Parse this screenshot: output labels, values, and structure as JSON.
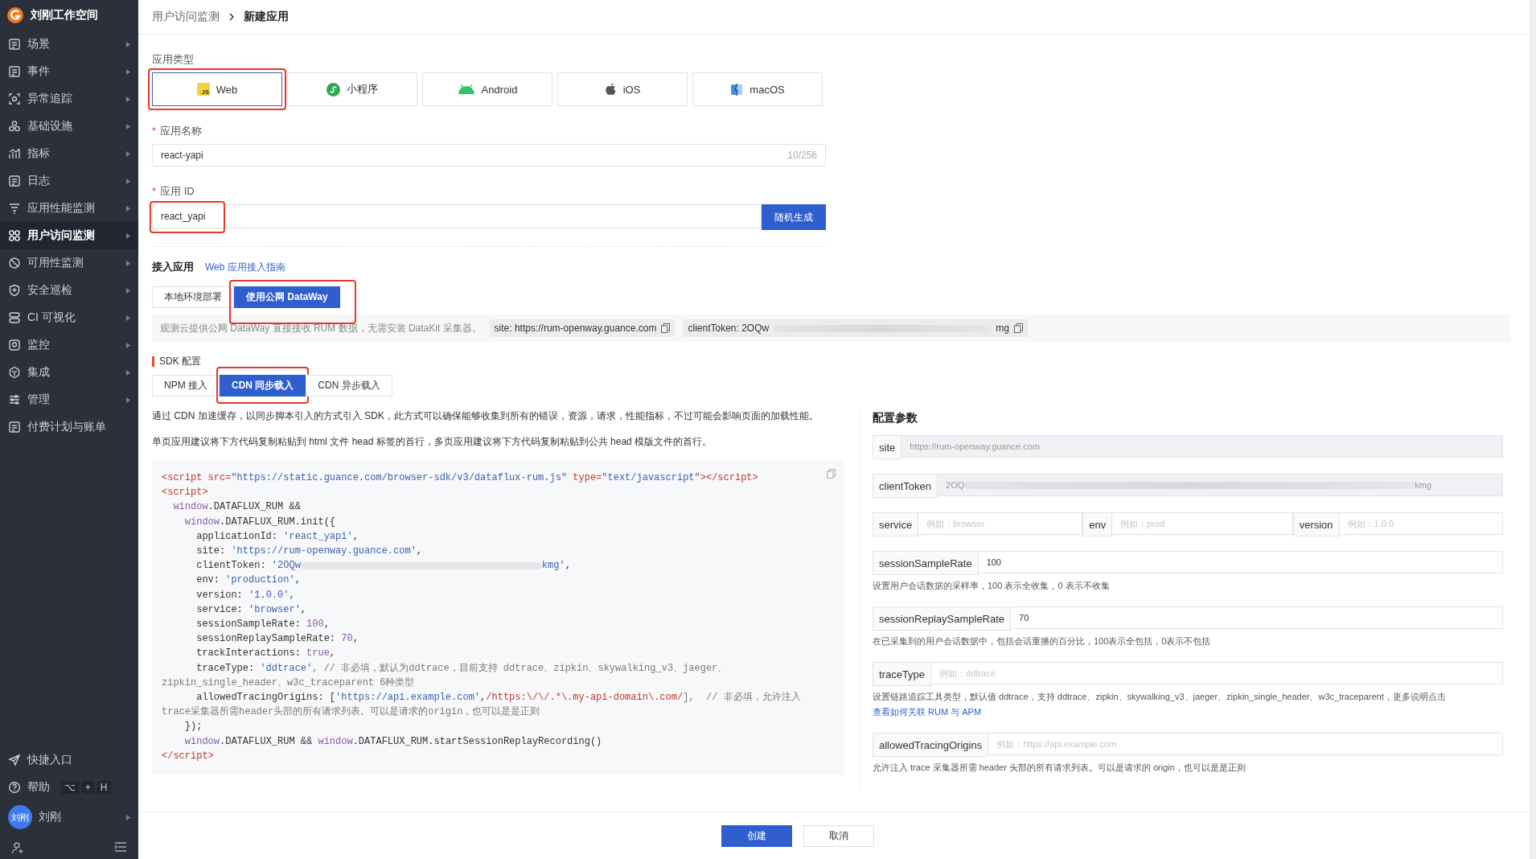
{
  "sidebar": {
    "workspace": "刘刚工作空间",
    "items": [
      {
        "label": "场景",
        "selected": false
      },
      {
        "label": "事件",
        "selected": false
      },
      {
        "label": "异常追踪",
        "selected": false
      },
      {
        "label": "基础设施",
        "selected": false
      },
      {
        "label": "指标",
        "selected": false
      },
      {
        "label": "日志",
        "selected": false
      },
      {
        "label": "应用性能监测",
        "selected": false
      },
      {
        "label": "用户访问监测",
        "selected": true
      },
      {
        "label": "可用性监测",
        "selected": false
      },
      {
        "label": "安全巡检",
        "selected": false
      },
      {
        "label": "CI 可视化",
        "selected": false
      },
      {
        "label": "监控",
        "selected": false
      },
      {
        "label": "集成",
        "selected": false
      },
      {
        "label": "管理",
        "selected": false
      },
      {
        "label": "付费计划与账单",
        "selected": false
      }
    ],
    "shortcut": "快捷入口",
    "help": "帮助",
    "help_keys": [
      "⌥",
      "+",
      "H"
    ],
    "user_avatar": "刘刚",
    "user_name": "刘刚"
  },
  "breadcrumb": [
    "用户访问监测",
    "新建应用"
  ],
  "app_type": {
    "label": "应用类型",
    "options": [
      {
        "label": "Web",
        "icon_text": "JS",
        "selected": true,
        "highlighted": true
      },
      {
        "label": "小程序",
        "selected": false,
        "highlighted": false
      },
      {
        "label": "Android",
        "selected": false,
        "highlighted": false
      },
      {
        "label": "iOS",
        "selected": false,
        "highlighted": false
      },
      {
        "label": "macOS",
        "selected": false,
        "highlighted": false
      }
    ]
  },
  "app_name": {
    "required_mark": "*",
    "label": "应用名称",
    "value": "react-yapi",
    "counter": "10/256"
  },
  "app_id": {
    "required_mark": "*",
    "label": "应用 ID",
    "value": "react_yapi",
    "highlighted": true,
    "button": "随机生成"
  },
  "access": {
    "title": "接入应用",
    "guide_link": "Web 应用接入指南",
    "tabs": [
      {
        "label": "本地环境部署",
        "selected": false,
        "highlighted": false
      },
      {
        "label": "使用公网 DataWay",
        "selected": true,
        "highlighted": true
      }
    ],
    "note": "观测云提供公网 DataWay 直接接收 RUM 数据，无需安装 DataKit 采集器。",
    "site": "site: https://rum-openway.guance.com",
    "token_start": "clientToken: 2OQw",
    "token_end": "mg"
  },
  "sdk": {
    "title": "SDK 配置",
    "tabs": [
      {
        "label": "NPM 接入",
        "selected": false,
        "highlighted": false
      },
      {
        "label": "CDN 同步载入",
        "selected": true,
        "highlighted": true
      },
      {
        "label": "CDN 异步载入",
        "selected": false,
        "highlighted": false
      }
    ],
    "desc": [
      "通过 CDN 加速缓存，以同步脚本引入的方式引入 SDK，此方式可以确保能够收集到所有的错误，资源，请求，性能指标，不过可能会影响页面的加载性能。",
      "单页应用建议将下方代码复制粘贴到 html 文件 head 标签的首行，多页应用建议将下方代码复制粘贴到公共 head 模版文件的首行。"
    ],
    "code": [
      [
        {
          "t": "<script ",
          "kind": "tag"
        },
        {
          "t": "src=",
          "kind": "tag"
        },
        {
          "t": "\"https://static.guance.com/browser-sdk/v3/dataflux-rum.js\"",
          "kind": "str"
        },
        {
          "t": " type=",
          "kind": "tag"
        },
        {
          "t": "\"text/javascript\"",
          "kind": "str"
        },
        {
          "t": "></script>",
          "kind": "tag"
        }
      ],
      [
        {
          "t": "<script>",
          "kind": "tag"
        }
      ],
      [
        {
          "t": "  window",
          "kind": "kw"
        },
        {
          "t": ".DATAFLUX_RUM &&",
          "kind": "plain"
        }
      ],
      [
        {
          "t": "    window",
          "kind": "kw"
        },
        {
          "t": ".DATAFLUX_RUM.init({",
          "kind": "plain"
        }
      ],
      [
        {
          "t": "      applicationId: ",
          "kind": "plain"
        },
        {
          "t": "'react_yapi'",
          "kind": "str"
        },
        {
          "t": ",",
          "kind": "plain"
        }
      ],
      [
        {
          "t": "      site: ",
          "kind": "plain"
        },
        {
          "t": "'https://rum-openway.guance.com'",
          "kind": "str"
        },
        {
          "t": ",",
          "kind": "plain"
        }
      ],
      [
        {
          "t": "      clientToken: ",
          "kind": "plain"
        },
        {
          "t": "'2OQw",
          "kind": "str"
        },
        {
          "kind": "redacted"
        },
        {
          "t": "kmg'",
          "kind": "str"
        },
        {
          "t": ",",
          "kind": "plain"
        }
      ],
      [
        {
          "t": "      env: ",
          "kind": "plain"
        },
        {
          "t": "'production'",
          "kind": "str"
        },
        {
          "t": ",",
          "kind": "plain"
        }
      ],
      [
        {
          "t": "      version: ",
          "kind": "plain"
        },
        {
          "t": "'1.0.0'",
          "kind": "str"
        },
        {
          "t": ",",
          "kind": "plain"
        }
      ],
      [
        {
          "t": "      service: ",
          "kind": "plain"
        },
        {
          "t": "'browser'",
          "kind": "str"
        },
        {
          "t": ",",
          "kind": "plain"
        }
      ],
      [
        {
          "t": "      sessionSampleRate: ",
          "kind": "plain"
        },
        {
          "t": "100",
          "kind": "num"
        },
        {
          "t": ",",
          "kind": "plain"
        }
      ],
      [
        {
          "t": "      sessionReplaySampleRate: ",
          "kind": "plain"
        },
        {
          "t": "70",
          "kind": "num"
        },
        {
          "t": ",",
          "kind": "plain"
        }
      ],
      [
        {
          "t": "      trackInteractions: ",
          "kind": "plain"
        },
        {
          "t": "true",
          "kind": "num"
        },
        {
          "t": ",",
          "kind": "plain"
        }
      ],
      [
        {
          "t": "      traceType: ",
          "kind": "plain"
        },
        {
          "t": "'ddtrace'",
          "kind": "str"
        },
        {
          "t": ", // 非必填，默认为ddtrace，目前支持 ddtrace、zipkin、skywalking_v3、jaeger、",
          "kind": "cm"
        }
      ],
      [
        {
          "t": "zipkin_single_header、w3c_traceparent 6种类型",
          "kind": "cm"
        }
      ],
      [
        {
          "t": "      allowedTracingOrigins: [",
          "kind": "plain"
        },
        {
          "t": "'https://api.example.com'",
          "kind": "str"
        },
        {
          "t": ",",
          "kind": "plain"
        },
        {
          "t": "/https:\\/\\/.*\\.my-api-domain\\.com/",
          "kind": "re"
        },
        {
          "t": "],  // 非必填，允许注入",
          "kind": "cm"
        }
      ],
      [
        {
          "t": "trace采集器所需header头部的所有请求列表。可以是请求的origin，也可以是是正则",
          "kind": "cm"
        }
      ],
      [
        {
          "t": "    });",
          "kind": "plain"
        }
      ],
      [
        {
          "t": "    window",
          "kind": "kw"
        },
        {
          "t": ".DATAFLUX_RUM && ",
          "kind": "plain"
        },
        {
          "t": "window",
          "kind": "kw"
        },
        {
          "t": ".DATAFLUX_RUM.startSessionReplayRecording()",
          "kind": "plain"
        }
      ],
      [
        {
          "t": "</script>",
          "kind": "tag"
        }
      ]
    ]
  },
  "config": {
    "title": "配置参数",
    "rows": [
      {
        "fields": [
          {
            "label": "site",
            "value": "https://rum-openway.guance.com",
            "readonly": true
          }
        ]
      },
      {
        "fields": [
          {
            "label": "clientToken",
            "value": "2OQ",
            "value_end": "kmg",
            "readonly": true
          }
        ]
      },
      {
        "fields": [
          {
            "label": "service",
            "placeholder": "例如：browser"
          },
          {
            "label": "env",
            "placeholder": "例如：prod"
          },
          {
            "label": "version",
            "placeholder": "例如：1.0.0"
          }
        ]
      },
      {
        "fields": [
          {
            "label": "sessionSampleRate",
            "value": "100"
          }
        ],
        "help": "设置用户会话数据的采样率，100 表示全收集，0 表示不收集"
      },
      {
        "fields": [
          {
            "label": "sessionReplaySampleRate",
            "value": "70"
          }
        ],
        "help": "在已采集到的用户会话数据中，包括会话重播的百分比，100表示全包括，0表示不包括"
      },
      {
        "fields": [
          {
            "label": "traceType",
            "placeholder": "例如：ddtrace"
          }
        ],
        "help": "设置链路追踪工具类型，默认值 ddtrace，支持 ddtrace、zipkin、skywalking_v3、jaeger、zipkin_single_header、w3c_traceparent，更多说明点击",
        "help_link": "查看如何关联 RUM 与 APM"
      },
      {
        "fields": [
          {
            "label": "allowedTracingOrigins",
            "placeholder": "例如：https://api.example.com"
          }
        ],
        "help": "允许注入 trace 采集器所需 header 头部的所有请求列表。可以是请求的 origin，也可以是是正则"
      }
    ]
  },
  "footer": {
    "buttons": [
      {
        "label": "创建",
        "kind": "primary"
      },
      {
        "label": "取消",
        "kind": "default"
      }
    ]
  }
}
